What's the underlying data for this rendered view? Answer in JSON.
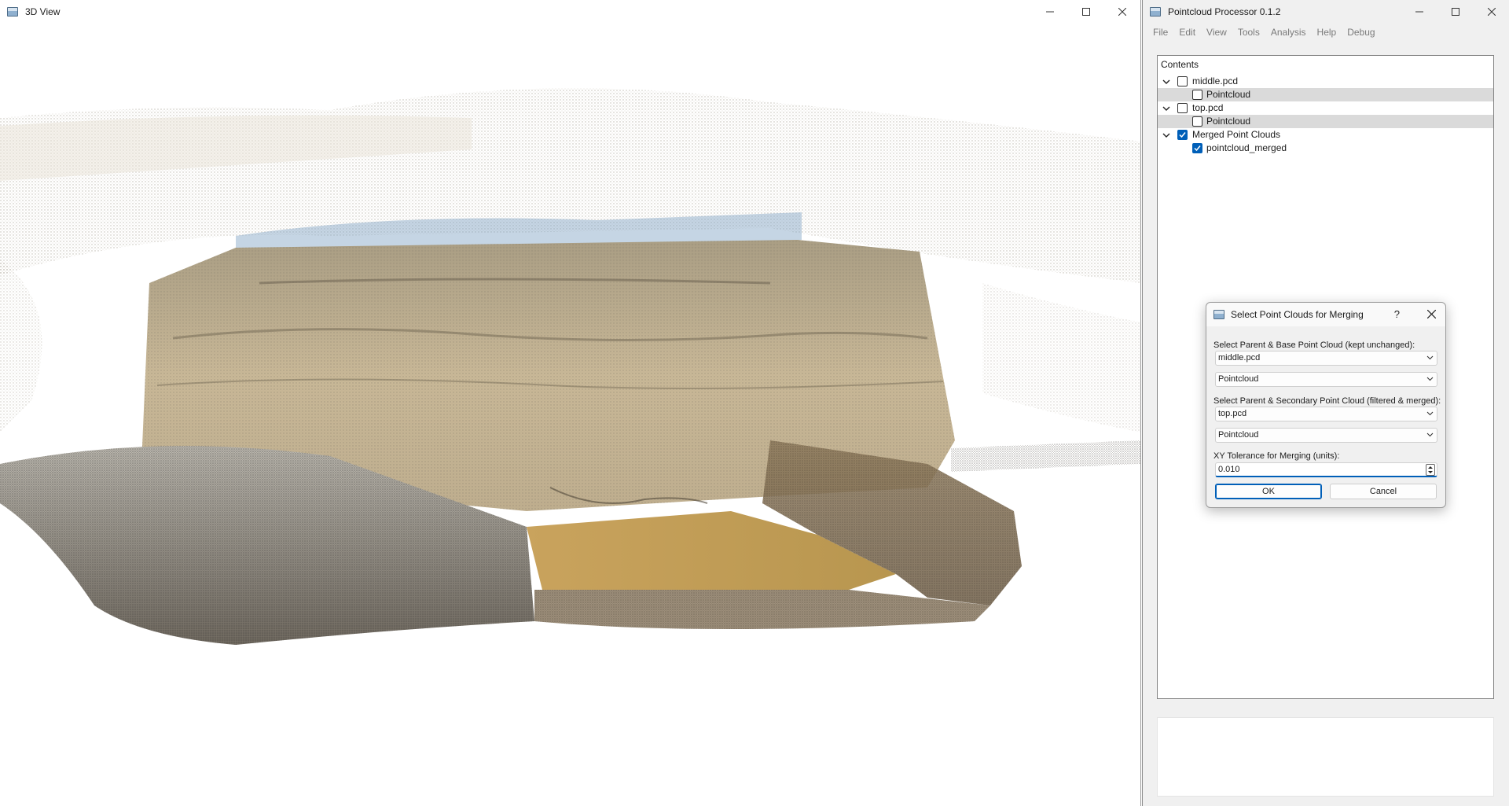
{
  "view3d": {
    "title": "3D View"
  },
  "main": {
    "title": "Pointcloud Processor 0.1.2",
    "menu": [
      "File",
      "Edit",
      "View",
      "Tools",
      "Analysis",
      "Help",
      "Debug"
    ],
    "tree": {
      "header": "Contents",
      "rows": [
        {
          "label": "middle.pcd",
          "checked": false,
          "expanded": true
        },
        {
          "label": "Pointcloud",
          "checked": false,
          "selected": true
        },
        {
          "label": "top.pcd",
          "checked": false,
          "expanded": true
        },
        {
          "label": "Pointcloud",
          "checked": false,
          "selected": true
        },
        {
          "label": "Merged Point Clouds",
          "checked": true,
          "expanded": true
        },
        {
          "label": "pointcloud_merged",
          "checked": true
        }
      ]
    }
  },
  "dialog": {
    "title": "Select Point Clouds for Merging",
    "help": "?",
    "base_label": "Select Parent & Base Point Cloud (kept unchanged):",
    "base_parent": "middle.pcd",
    "base_child": "Pointcloud",
    "secondary_label": "Select Parent & Secondary Point Cloud (filtered & merged):",
    "secondary_parent": "top.pcd",
    "secondary_child": "Pointcloud",
    "tolerance_label": "XY Tolerance for Merging (units):",
    "tolerance_value": "0.010",
    "ok_label": "OK",
    "cancel_label": "Cancel"
  },
  "colors": {
    "accent": "#005fb8",
    "selection": "#dadada",
    "menu_disabled": "#7a7a7a"
  },
  "icons": [
    "app-icon",
    "minimize-icon",
    "maximize-icon",
    "close-icon",
    "chevron-down-icon",
    "checkbox-icon",
    "dropdown-arrow-icon",
    "spin-arrows-icon",
    "help-icon"
  ]
}
